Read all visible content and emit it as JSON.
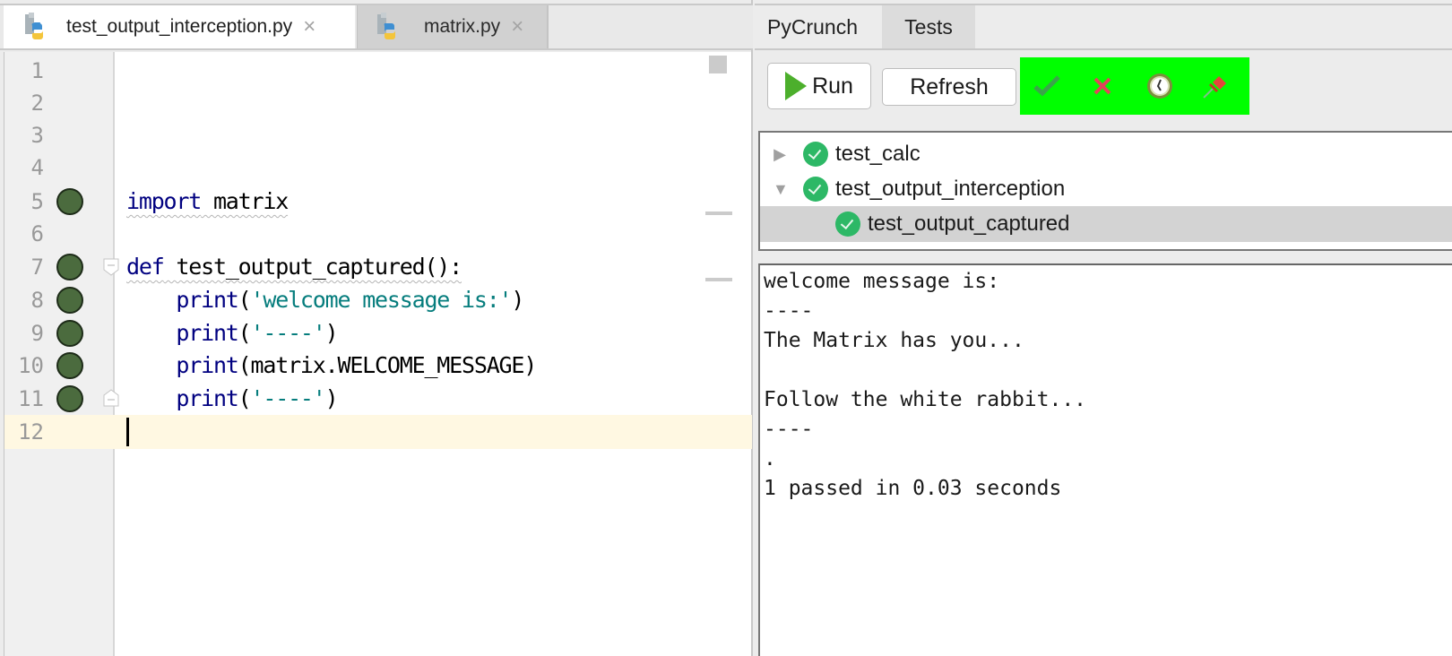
{
  "editor": {
    "tabs": [
      {
        "label": "test_output_interception.py",
        "active": true,
        "icon": "python-file-icon"
      },
      {
        "label": "matrix.py",
        "active": false,
        "icon": "python-file-icon"
      }
    ],
    "close_glyph": "×",
    "lines": [
      {
        "number": "1",
        "covered": false
      },
      {
        "number": "2",
        "covered": false
      },
      {
        "number": "3",
        "covered": false
      },
      {
        "number": "4",
        "covered": false
      },
      {
        "number": "5",
        "covered": true
      },
      {
        "number": "6",
        "covered": false
      },
      {
        "number": "7",
        "covered": true
      },
      {
        "number": "8",
        "covered": true
      },
      {
        "number": "9",
        "covered": true
      },
      {
        "number": "10",
        "covered": true
      },
      {
        "number": "11",
        "covered": true
      },
      {
        "number": "12",
        "covered": false
      }
    ],
    "code": {
      "l5_kw": "import",
      "l5_rest": " matrix",
      "l7_kw": "def",
      "l7_rest": " test_output_captured():",
      "l8_fn": "    print",
      "l8_open": "(",
      "l8_str": "'welcome message is:'",
      "l8_close": ")",
      "l9_fn": "    print",
      "l9_open": "(",
      "l9_str": "'----'",
      "l9_close": ")",
      "l10_fn": "    print",
      "l10_rest": "(matrix.WELCOME_MESSAGE)",
      "l11_fn": "    print",
      "l11_open": "(",
      "l11_str": "'----'",
      "l11_close": ")"
    },
    "current_line": "12",
    "colors": {
      "covered": "#4b6b3e",
      "keyword": "#000080",
      "string": "#067d7d",
      "current_line_bg": "#fff8e2"
    }
  },
  "panel": {
    "tabs": [
      {
        "label": "PyCrunch",
        "active": false
      },
      {
        "label": "Tests",
        "active": true
      }
    ],
    "toolbar": {
      "run_label": "Run",
      "refresh_label": "Refresh",
      "filters": [
        {
          "name": "show-passed",
          "icon": "checkmark-icon"
        },
        {
          "name": "show-failed",
          "icon": "cross-icon"
        },
        {
          "name": "show-queued",
          "icon": "clock-icon"
        },
        {
          "name": "show-pinned",
          "icon": "pin-icon"
        }
      ],
      "filter_bar_color": "#00ff00"
    },
    "tree": [
      {
        "label": "test_calc",
        "status": "passed",
        "expanded": false,
        "level": 0,
        "arrow": "▶"
      },
      {
        "label": "test_output_interception",
        "status": "passed",
        "expanded": true,
        "level": 0,
        "arrow": "▼"
      },
      {
        "label": "test_output_captured",
        "status": "passed",
        "level": 1,
        "selected": true
      }
    ],
    "output": "welcome message is:\n----\nThe Matrix has you...\n\nFollow the white rabbit...\n----\n.\n1 passed in 0.03 seconds"
  }
}
